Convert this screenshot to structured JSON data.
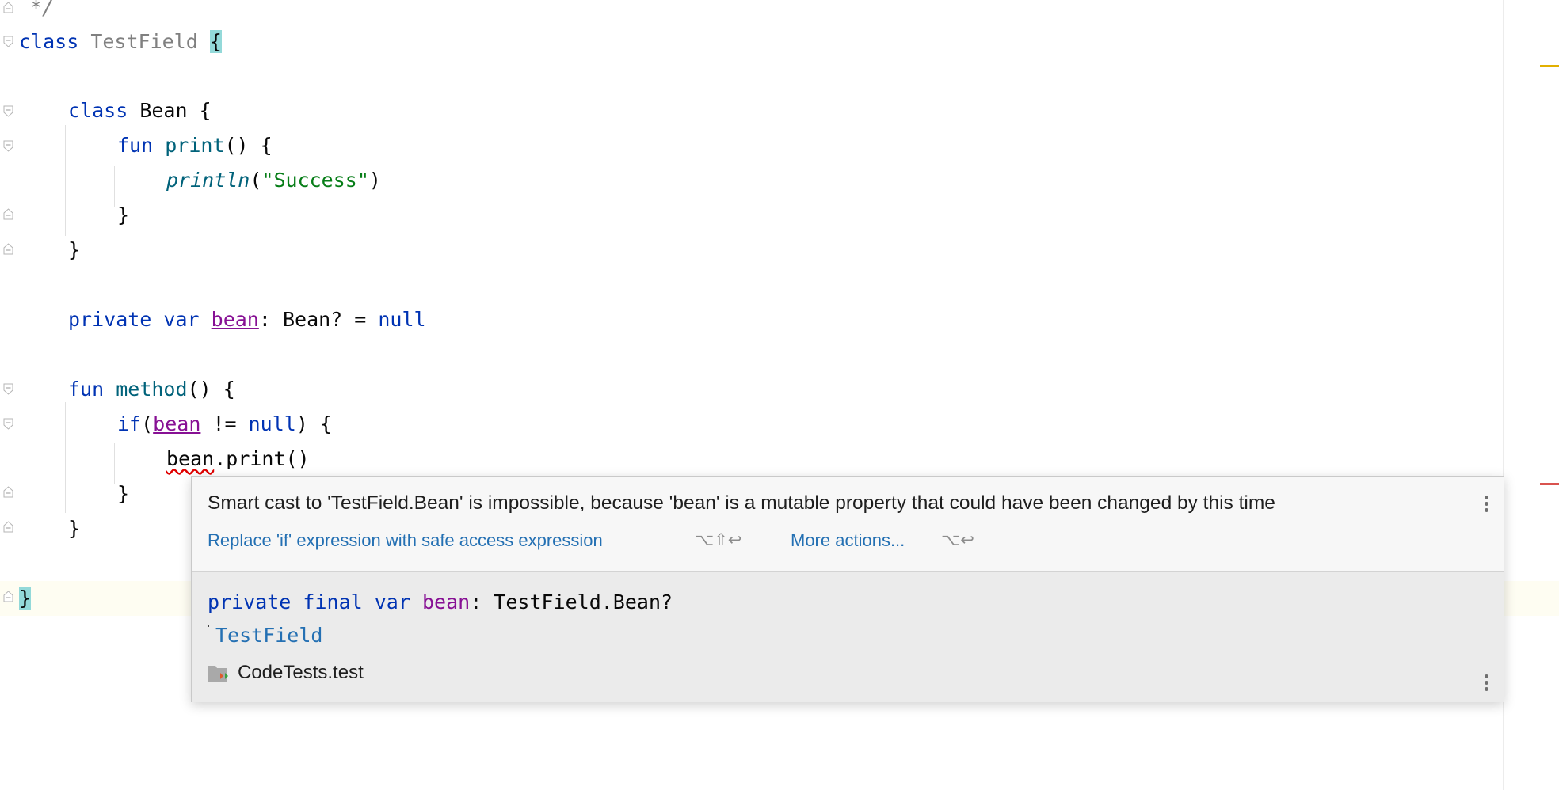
{
  "code": {
    "comment_end": "*/",
    "kw_class": "class",
    "class_name": "TestField",
    "open_brace": "{",
    "close_brace": "}",
    "bean_class": "Bean",
    "kw_fun": "fun",
    "print_fn": "print",
    "parens": "()",
    "println_fn": "println",
    "open_paren": "(",
    "close_paren": ")",
    "success_str": "\"Success\"",
    "kw_private": "private",
    "kw_var": "var",
    "bean_prop": "bean",
    "bean_type_decl": ": Bean? = ",
    "kw_null": "null",
    "method_fn": "method",
    "kw_if": "if",
    "neq": " != ",
    "bean_call": ".print()"
  },
  "popup": {
    "message": "Smart cast to 'TestField.Bean' is impossible, because 'bean' is a mutable property that could have been changed by this time",
    "fix_label": "Replace 'if' expression with safe access expression",
    "fix_shortcut": "⌥⇧↩",
    "more_label": "More actions...",
    "more_shortcut": "⌥↩",
    "doc": {
      "kw_private": "private",
      "kw_final": "final",
      "kw_var": "var",
      "prop": "bean",
      "type": ": TestField.Bean?",
      "containing_class": "TestField",
      "module": "CodeTests.test"
    }
  },
  "colors": {
    "keyword": "#0033b3",
    "function": "#00627a",
    "string": "#067d17",
    "property": "#871094",
    "link": "#2470b3",
    "warning_mark": "#e2b000",
    "error_mark": "#d9534f"
  }
}
